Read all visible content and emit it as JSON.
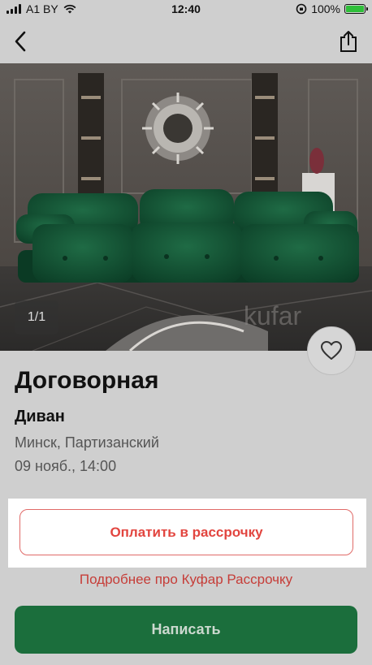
{
  "status_bar": {
    "carrier": "A1 BY",
    "time": "12:40",
    "battery": "100%"
  },
  "photo": {
    "counter": "1/1",
    "watermark": "kufar"
  },
  "listing": {
    "price": "Договорная",
    "title": "Диван",
    "location": "Минск, Партизанский",
    "date": "09 нояб., 14:00"
  },
  "actions": {
    "installment_button": "Оплатить в рассрочку",
    "installment_link": "Подробнее про Куфар Рассрочку",
    "write_button": "Написать"
  },
  "icons": {
    "back": "back-icon",
    "share": "share-icon",
    "favorite": "heart-icon",
    "wifi": "wifi-icon",
    "signal": "signal-icon",
    "battery": "battery-icon",
    "rotation_lock": "rotation-lock-icon"
  },
  "colors": {
    "accent_red": "#e2453f",
    "primary_green": "#1b6e3c",
    "background": "#cfcfcf"
  }
}
